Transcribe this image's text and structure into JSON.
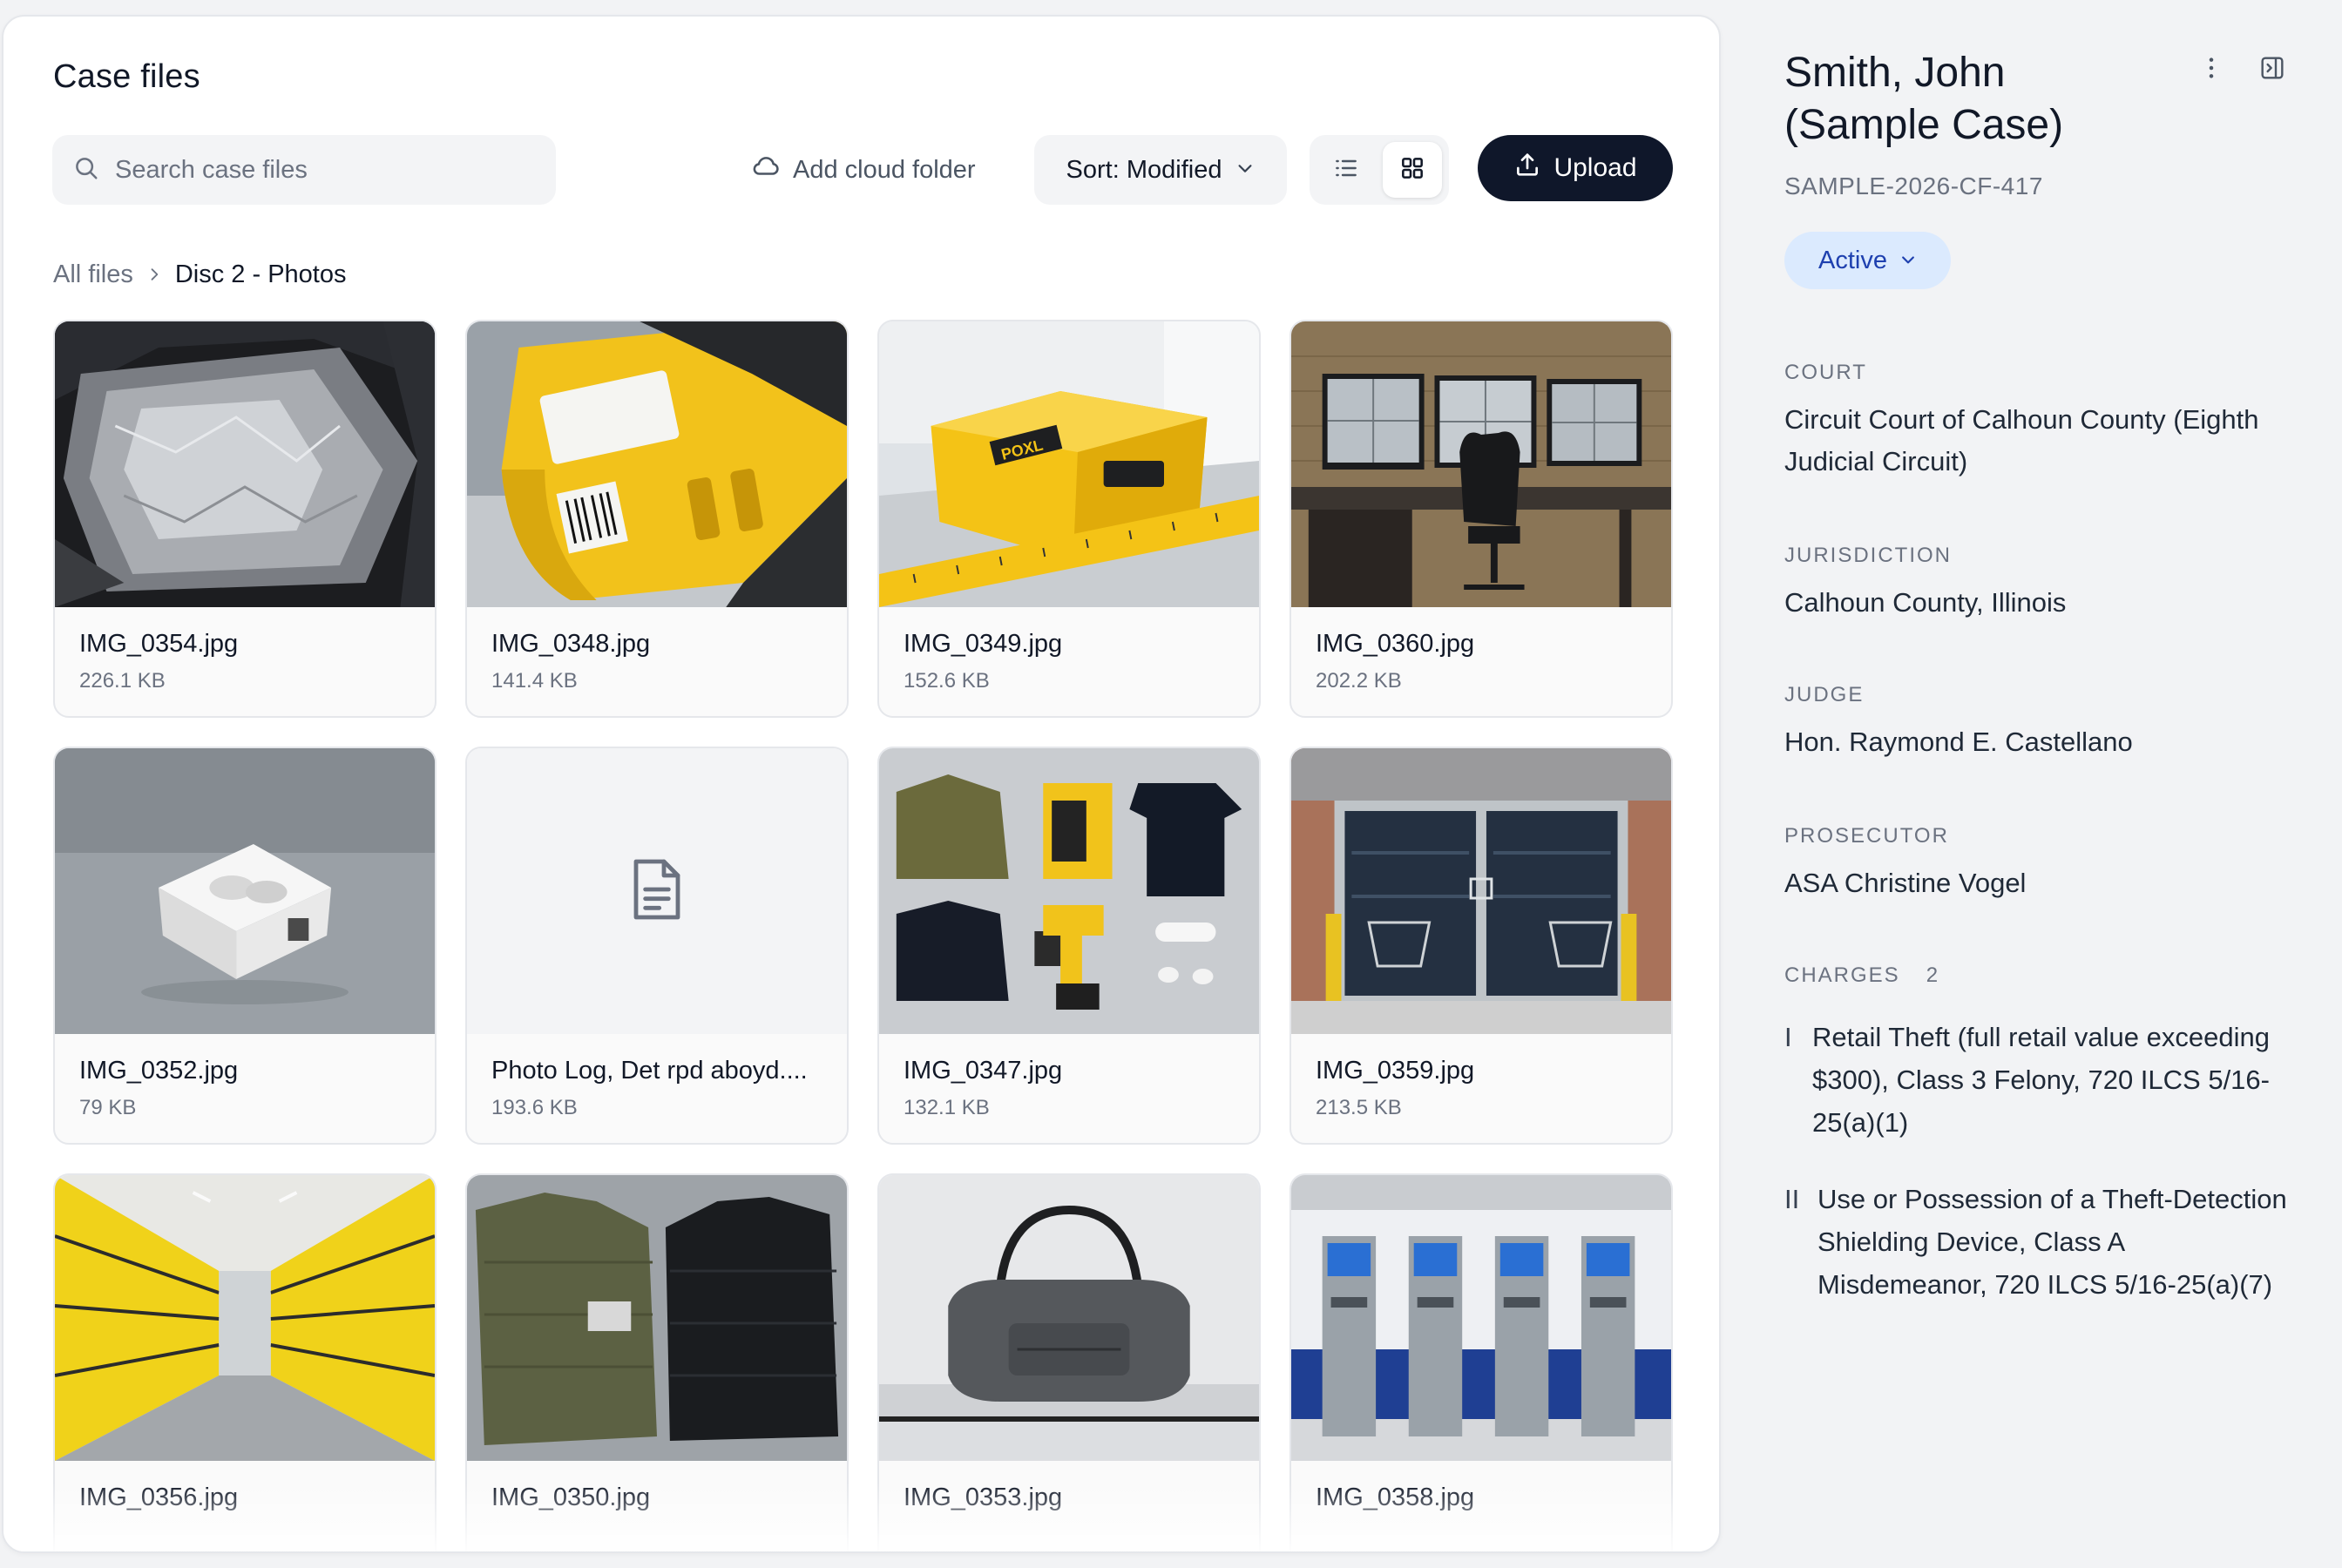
{
  "main": {
    "title": "Case files",
    "search": {
      "placeholder": "Search case files",
      "value": ""
    },
    "add_cloud_label": "Add cloud folder",
    "sort_label": "Sort: Modified",
    "view_mode": "grid",
    "upload_label": "Upload",
    "breadcrumb": {
      "root": "All files",
      "current": "Disc 2 - Photos"
    },
    "files": [
      {
        "name": "IMG_0354.jpg",
        "size": "226.1 KB",
        "icon": "photo"
      },
      {
        "name": "IMG_0348.jpg",
        "size": "141.4 KB",
        "icon": "photo"
      },
      {
        "name": "IMG_0349.jpg",
        "size": "152.6 KB",
        "icon": "photo"
      },
      {
        "name": "IMG_0360.jpg",
        "size": "202.2 KB",
        "icon": "photo"
      },
      {
        "name": "IMG_0352.jpg",
        "size": "79 KB",
        "icon": "photo"
      },
      {
        "name": "Photo Log, Det rpd aboyd....",
        "size": "193.6 KB",
        "icon": "document-icon"
      },
      {
        "name": "IMG_0347.jpg",
        "size": "132.1 KB",
        "icon": "photo"
      },
      {
        "name": "IMG_0359.jpg",
        "size": "213.5 KB",
        "icon": "photo"
      },
      {
        "name": "IMG_0356.jpg",
        "size": "",
        "icon": "photo"
      },
      {
        "name": "IMG_0350.jpg",
        "size": "",
        "icon": "photo"
      },
      {
        "name": "IMG_0353.jpg",
        "size": "",
        "icon": "photo"
      },
      {
        "name": "IMG_0358.jpg",
        "size": "",
        "icon": "photo"
      }
    ]
  },
  "case": {
    "title": "Smith, John (Sample Case)",
    "id": "SAMPLE-2026-CF-417",
    "status": "Active",
    "court_label": "COURT",
    "court": "Circuit Court of Calhoun County (Eighth Judicial Circuit)",
    "jurisdiction_label": "JURISDICTION",
    "jurisdiction": "Calhoun County, Illinois",
    "judge_label": "JUDGE",
    "judge": "Hon. Raymond E. Castellano",
    "prosecutor_label": "PROSECUTOR",
    "prosecutor": "ASA Christine Vogel",
    "charges_label": "CHARGES",
    "charges_count": "2",
    "charges": [
      {
        "num": "I",
        "text": "Retail Theft (full retail value exceeding $300), Class 3 Felony, 720 ILCS 5/16-25(a)(1)"
      },
      {
        "num": "II",
        "text": "Use or Possession of a Theft-Detection Shielding Device, Class A Misdemeanor, 720 ILCS 5/16-25(a)(7)"
      }
    ]
  },
  "colors": {
    "upload_bg": "#0f172a",
    "status_bg": "#dbeafe",
    "status_text": "#1e40af",
    "page_bg": "#f2f3f5"
  }
}
